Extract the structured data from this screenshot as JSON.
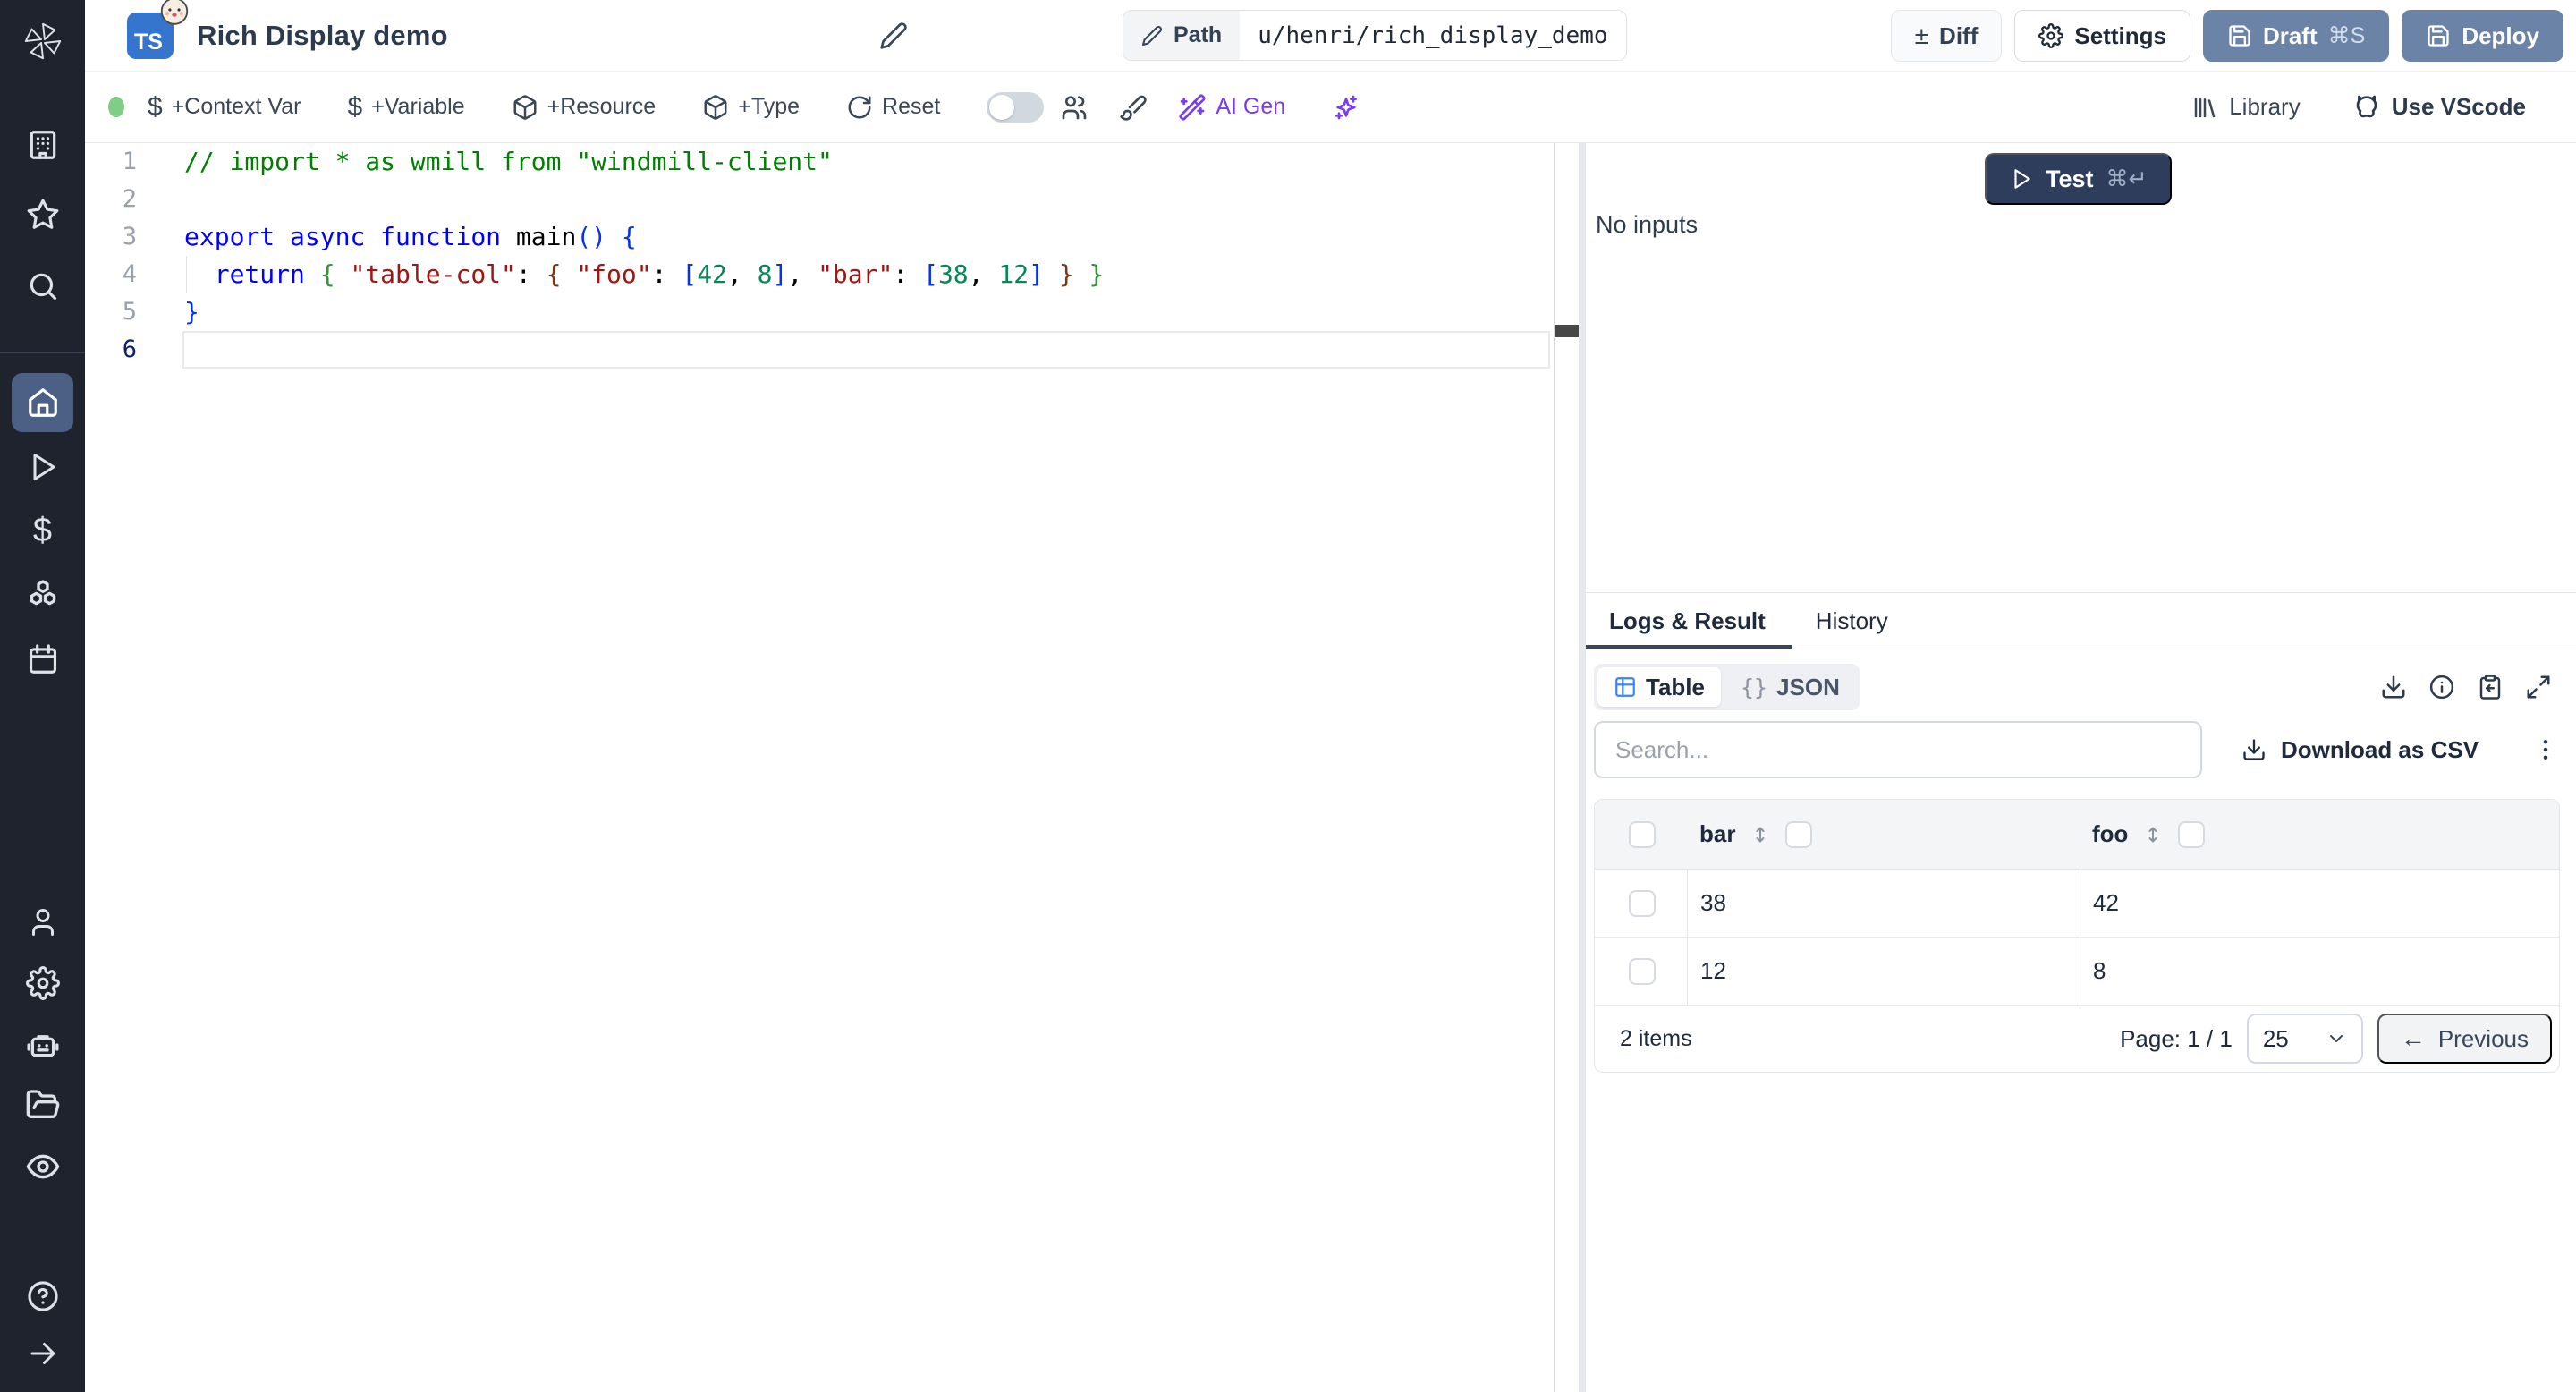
{
  "header": {
    "language_badge": "TS",
    "title": "Rich Display demo",
    "path": {
      "label": "Path",
      "value": "u/henri/rich_display_demo"
    },
    "actions": {
      "diff": "Diff",
      "settings": "Settings",
      "draft": "Draft",
      "draft_shortcut": "⌘S",
      "deploy": "Deploy"
    }
  },
  "toolbar": {
    "context_var": "+Context Var",
    "variable": "+Variable",
    "resource": "+Resource",
    "type": "+Type",
    "reset": "Reset",
    "ai_gen": "AI Gen",
    "library": "Library",
    "vscode": "Use VScode"
  },
  "editor": {
    "lines": [
      {
        "num": "1",
        "tokens": [
          [
            "com",
            "// import * as wmill from \"windmill-client\""
          ]
        ]
      },
      {
        "num": "2",
        "tokens": []
      },
      {
        "num": "3",
        "tokens": [
          [
            "kw",
            "export"
          ],
          [
            "pl",
            " "
          ],
          [
            "kw",
            "async"
          ],
          [
            "pl",
            " "
          ],
          [
            "kw",
            "function"
          ],
          [
            "pl",
            " "
          ],
          [
            "id",
            "main"
          ],
          [
            "b1",
            "()"
          ],
          [
            "pl",
            " "
          ],
          [
            "b1",
            "{"
          ]
        ]
      },
      {
        "num": "4",
        "tokens": [
          [
            "pl",
            "  "
          ],
          [
            "kw",
            "return"
          ],
          [
            "pl",
            " "
          ],
          [
            "b2",
            "{"
          ],
          [
            "pl",
            " "
          ],
          [
            "str",
            "\"table-col\""
          ],
          [
            "pl",
            ": "
          ],
          [
            "b3",
            "{"
          ],
          [
            "pl",
            " "
          ],
          [
            "str",
            "\"foo\""
          ],
          [
            "pl",
            ": "
          ],
          [
            "b1",
            "["
          ],
          [
            "num",
            "42"
          ],
          [
            "pl",
            ", "
          ],
          [
            "num",
            "8"
          ],
          [
            "b1",
            "]"
          ],
          [
            "pl",
            ", "
          ],
          [
            "str",
            "\"bar\""
          ],
          [
            "pl",
            ": "
          ],
          [
            "b1",
            "["
          ],
          [
            "num",
            "38"
          ],
          [
            "pl",
            ", "
          ],
          [
            "num",
            "12"
          ],
          [
            "b1",
            "]"
          ],
          [
            "pl",
            " "
          ],
          [
            "b3",
            "}"
          ],
          [
            "pl",
            " "
          ],
          [
            "b2",
            "}"
          ]
        ]
      },
      {
        "num": "5",
        "tokens": [
          [
            "b1",
            "}"
          ]
        ]
      },
      {
        "num": "6",
        "tokens": [],
        "active": true
      }
    ]
  },
  "run": {
    "test": "Test",
    "test_shortcut": "⌘↵",
    "no_inputs": "No inputs"
  },
  "result": {
    "tabs": {
      "logs": "Logs & Result",
      "history": "History"
    },
    "views": {
      "table": "Table",
      "json_glyph": "{}",
      "json": "JSON"
    },
    "search_placeholder": "Search...",
    "download_csv": "Download as CSV",
    "table": {
      "columns": [
        "bar",
        "foo"
      ],
      "rows": [
        [
          "38",
          "42"
        ],
        [
          "12",
          "8"
        ]
      ]
    },
    "footer": {
      "items": "2 items",
      "page": "Page: 1 / 1",
      "page_size": "25",
      "previous": "Previous"
    }
  },
  "glyphs": {
    "plus_minus": "±",
    "kebab": "⋮",
    "arrow_left": "←",
    "dollar": "$"
  },
  "icons": {
    "sidebar": [
      "windmill-logo",
      "building",
      "star",
      "search",
      "home",
      "play",
      "dollar",
      "cubes",
      "calendar",
      "user",
      "settings",
      "worker-robot",
      "folder-open",
      "eye",
      "help",
      "expand-arrow"
    ],
    "result_actions": [
      "download",
      "info",
      "clipboard-copy",
      "expand"
    ]
  },
  "colors": {
    "sidebar_bg": "#1e232e",
    "active_nav": "#4c5f85",
    "slate_button": "#6b83a6",
    "test_button": "#2f3d5c",
    "ai_purple": "#7c3aed",
    "status_green": "#82cc8a",
    "ts_blue": "#3575cd",
    "table_icon_blue": "#3b82f6"
  }
}
